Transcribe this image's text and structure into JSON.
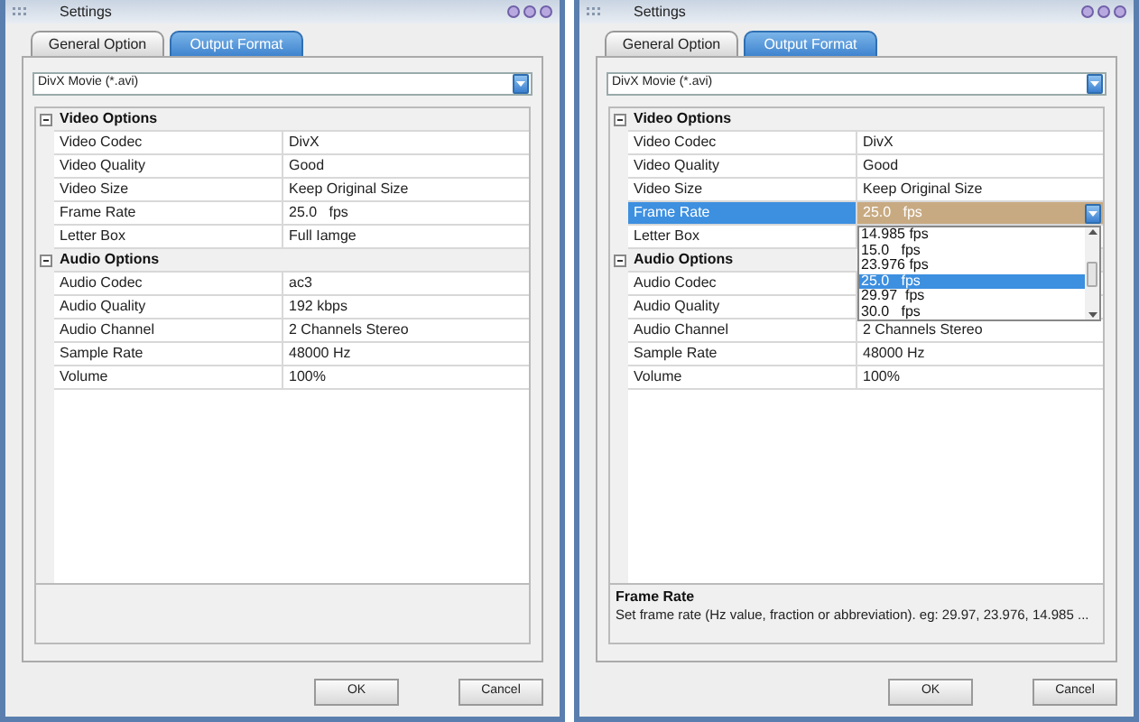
{
  "windows": [
    {
      "title": "Settings",
      "tabs": [
        {
          "label": "General Option",
          "selected": false
        },
        {
          "label": "Output Format",
          "selected": true
        }
      ],
      "format": "DivX Movie (*.avi)",
      "sections": [
        {
          "title": "Video Options",
          "expanded": true,
          "rows": [
            {
              "name": "Video Codec",
              "value": "DivX",
              "selected": false
            },
            {
              "name": "Video Quality",
              "value": "Good",
              "selected": false
            },
            {
              "name": "Video Size",
              "value": "Keep Original Size",
              "selected": false
            },
            {
              "name": "Frame Rate",
              "value": "25.0   fps",
              "selected": false
            },
            {
              "name": "Letter Box",
              "value": "Full Iamge",
              "selected": false
            }
          ]
        },
        {
          "title": "Audio Options",
          "expanded": true,
          "rows": [
            {
              "name": "Audio Codec",
              "value": "ac3",
              "selected": false
            },
            {
              "name": "Audio Quality",
              "value": "192 kbps",
              "selected": false
            },
            {
              "name": "Audio Channel",
              "value": "2 Channels Stereo",
              "selected": false
            },
            {
              "name": "Sample Rate",
              "value": "48000 Hz",
              "selected": false
            },
            {
              "name": "Volume",
              "value": "100%",
              "selected": false
            }
          ]
        }
      ],
      "buttons": [
        "OK",
        "Cancel"
      ]
    },
    {
      "title": "Settings",
      "tabs": [
        {
          "label": "General Option",
          "selected": false
        },
        {
          "label": "Output Format",
          "selected": true
        }
      ],
      "format": "DivX Movie (*.avi)",
      "sections": [
        {
          "title": "Video Options",
          "expanded": true,
          "rows": [
            {
              "name": "Video Codec",
              "value": "DivX",
              "selected": false
            },
            {
              "name": "Video Quality",
              "value": "Good",
              "selected": false
            },
            {
              "name": "Video Size",
              "value": "Keep Original Size",
              "selected": false
            },
            {
              "name": "Frame Rate",
              "value": "25.0   fps",
              "selected": true,
              "dropdown": [
                {
                  "label": "14.985 fps",
                  "selected": false
                },
                {
                  "label": "15.0   fps",
                  "selected": false
                },
                {
                  "label": "23.976 fps",
                  "selected": false
                },
                {
                  "label": "25.0   fps",
                  "selected": true
                },
                {
                  "label": "29.97  fps",
                  "selected": false
                },
                {
                  "label": "30.0   fps",
                  "selected": false
                }
              ]
            },
            {
              "name": "Letter Box",
              "value": "",
              "selected": false
            }
          ]
        },
        {
          "title": "Audio Options",
          "expanded": true,
          "rows": [
            {
              "name": "Audio Codec",
              "value": "",
              "selected": false
            },
            {
              "name": "Audio Quality",
              "value": "",
              "selected": false
            },
            {
              "name": "Audio Channel",
              "value": "2 Channels Stereo",
              "selected": false
            },
            {
              "name": "Sample Rate",
              "value": "48000 Hz",
              "selected": false
            },
            {
              "name": "Volume",
              "value": "100%",
              "selected": false
            }
          ]
        }
      ],
      "description": {
        "title": "Frame Rate",
        "text": "Set frame rate (Hz value, fraction or abbreviation). eg: 29.97, 23.976, 14.985 ..."
      },
      "buttons": [
        "OK",
        "Cancel"
      ]
    }
  ]
}
